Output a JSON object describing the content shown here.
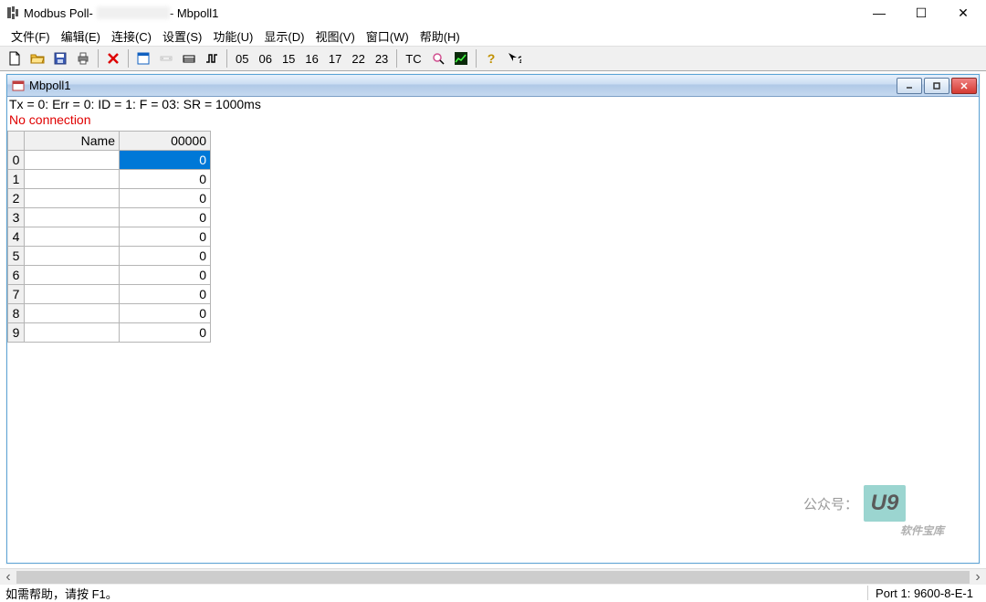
{
  "window": {
    "title_prefix": "Modbus Poll-",
    "title_suffix": "- Mbpoll1",
    "controls": {
      "min": "—",
      "max": "☐",
      "close": "✕"
    }
  },
  "menu": {
    "items": [
      "文件(F)",
      "编辑(E)",
      "连接(C)",
      "设置(S)",
      "功能(U)",
      "显示(D)",
      "视图(V)",
      "窗口(W)",
      "帮助(H)"
    ]
  },
  "toolbar": {
    "numbers": [
      "05",
      "06",
      "15",
      "16",
      "17",
      "22",
      "23"
    ],
    "tc_label": "TC"
  },
  "child": {
    "title": "Mbpoll1",
    "status_line1": "Tx = 0: Err = 0: ID = 1: F = 03: SR = 1000ms",
    "status_line2": "No connection",
    "headers": {
      "idx": "",
      "name": "Name",
      "val": "00000"
    },
    "rows": [
      {
        "idx": "0",
        "name": "",
        "val": "0",
        "selected": true
      },
      {
        "idx": "1",
        "name": "",
        "val": "0"
      },
      {
        "idx": "2",
        "name": "",
        "val": "0"
      },
      {
        "idx": "3",
        "name": "",
        "val": "0"
      },
      {
        "idx": "4",
        "name": "",
        "val": "0"
      },
      {
        "idx": "5",
        "name": "",
        "val": "0"
      },
      {
        "idx": "6",
        "name": "",
        "val": "0"
      },
      {
        "idx": "7",
        "name": "",
        "val": "0"
      },
      {
        "idx": "8",
        "name": "",
        "val": "0"
      },
      {
        "idx": "9",
        "name": "",
        "val": "0"
      }
    ]
  },
  "watermark": {
    "prefix": "公众号：",
    "logo": "U9",
    "sub": "软件宝库"
  },
  "statusbar": {
    "help": "如需帮助，请按 F1。",
    "port": "Port 1: 9600-8-E-1"
  }
}
